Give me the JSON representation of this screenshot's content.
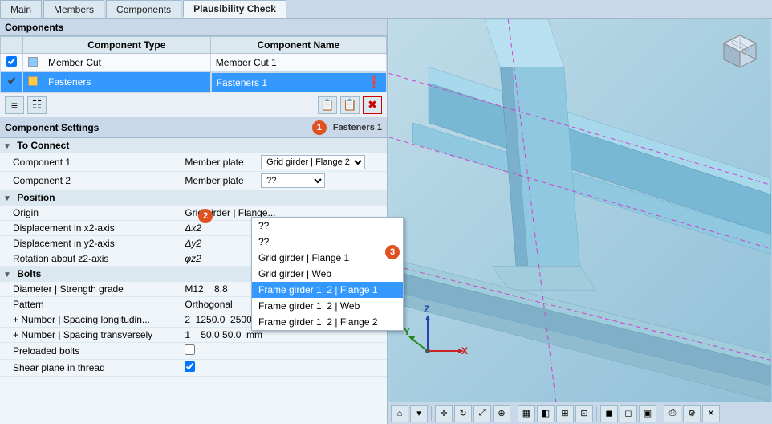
{
  "tabs": [
    {
      "id": "main",
      "label": "Main",
      "active": false
    },
    {
      "id": "members",
      "label": "Members",
      "active": false
    },
    {
      "id": "components",
      "label": "Components",
      "active": false
    },
    {
      "id": "plausibility",
      "label": "Plausibility Check",
      "active": true
    }
  ],
  "components_section": {
    "title": "Components",
    "table": {
      "headers": [
        "",
        "",
        "Component Type",
        "Component Name"
      ],
      "rows": [
        {
          "checked": true,
          "color": "#88ccff",
          "type": "Member Cut",
          "name": "Member Cut 1",
          "selected": false,
          "alert": false
        },
        {
          "checked": true,
          "color": "#ffcc44",
          "type": "Fasteners",
          "name": "Fasteners 1",
          "selected": true,
          "alert": true
        }
      ]
    }
  },
  "toolbar": {
    "buttons": [
      "add_list",
      "add_component",
      "copy",
      "copy2",
      "delete"
    ]
  },
  "component_settings": {
    "title": "Component Settings",
    "badge_number": "1",
    "component_name": "Fasteners 1",
    "groups": [
      {
        "name": "To Connect",
        "rows": [
          {
            "label": "Component 1",
            "value": "Member plate",
            "dropdown": "Grid girder | Flange 2",
            "has_dropdown": true
          },
          {
            "label": "Component 2",
            "value": "Member plate",
            "dropdown": "??",
            "has_dropdown": true,
            "dropdown_open": true
          }
        ]
      },
      {
        "name": "Position",
        "rows": [
          {
            "label": "Origin",
            "value": "Grid girder | Flange...",
            "symbol": ""
          },
          {
            "label": "Displacement in x2-axis",
            "symbol": "Δx2",
            "value": ""
          },
          {
            "label": "Displacement in y2-axis",
            "symbol": "Δy2",
            "value": ""
          },
          {
            "label": "Rotation about z2-axis",
            "symbol": "φz2",
            "value": ""
          }
        ]
      },
      {
        "name": "Bolts",
        "rows": [
          {
            "label": "Diameter | Strength grade",
            "value": "M12    8.8"
          },
          {
            "label": "Pattern",
            "value": "Orthogonal"
          },
          {
            "label": "Number | Spacing longitudin...",
            "value": "2    1250.0  2500.0  1250.0  mm"
          },
          {
            "label": "Number | Spacing transversely",
            "value": "1    50.0 50.0  mm"
          },
          {
            "label": "Preloaded bolts",
            "value": "checkbox_unchecked"
          },
          {
            "label": "Shear plane in thread",
            "value": "checkbox_checked"
          }
        ]
      }
    ]
  },
  "dropdown_options": [
    {
      "label": "??",
      "selected": false
    },
    {
      "label": "??",
      "selected": false
    },
    {
      "label": "Grid girder | Flange 1",
      "selected": false
    },
    {
      "label": "Grid girder | Web",
      "selected": false
    },
    {
      "label": "Frame girder 1, 2 | Flange 1",
      "selected": true
    },
    {
      "label": "Frame girder 1, 2 | Web",
      "selected": false
    },
    {
      "label": "Frame girder 1, 2 | Flange 2",
      "selected": false
    }
  ],
  "viewport": {
    "axis": {
      "x_label": "X",
      "y_label": "Y",
      "z_label": "Z"
    }
  },
  "colors": {
    "tab_active_bg": "#f0f5fa",
    "tab_inactive_bg": "#dce8f0",
    "accent_blue": "#3399ff",
    "alert_red": "#cc0000",
    "badge_orange": "#e05020"
  }
}
